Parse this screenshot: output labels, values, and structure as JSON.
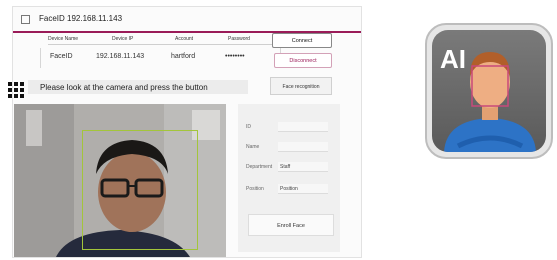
{
  "window": {
    "title": "FaceID  192.168.11.143"
  },
  "connection": {
    "headers": [
      "Device Name",
      "Device IP",
      "Account",
      "Password"
    ],
    "row": {
      "device_name": "FaceID",
      "device_ip": "192.168.11.143",
      "account": "hartford",
      "password": "••••••••"
    },
    "connect_label": "Connect",
    "disconnect_label": "Disconnect"
  },
  "prompt": "Please look at the camera and press the button",
  "face_recognition_label": "Face recognition",
  "form": {
    "fields": [
      {
        "label": "ID",
        "value": ""
      },
      {
        "label": "Name",
        "value": ""
      },
      {
        "label": "Department",
        "value": "Staff"
      },
      {
        "label": "Position",
        "value": "Position"
      }
    ],
    "enroll_label": "Enroll Face"
  },
  "logo_text": "AI",
  "colors": {
    "accent": "#9a1b58",
    "face_box": "#a3c53b",
    "logo_bg": "#6c6c6c",
    "shirt": "#2d73c6"
  }
}
